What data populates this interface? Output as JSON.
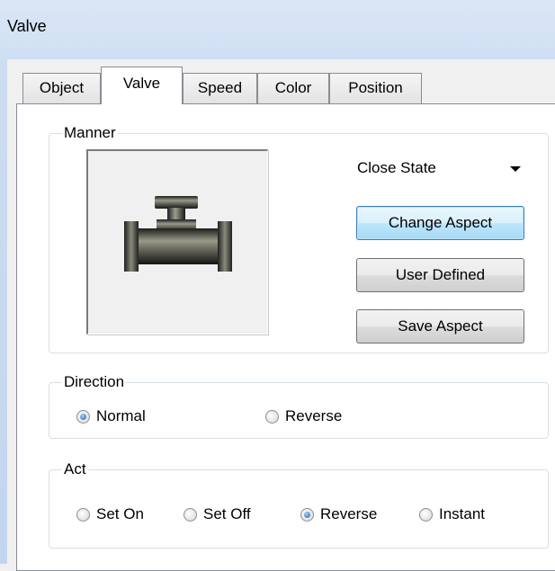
{
  "window": {
    "title": "Valve"
  },
  "tabs": [
    {
      "label": "Object",
      "active": false
    },
    {
      "label": "Valve",
      "active": true
    },
    {
      "label": "Speed",
      "active": false
    },
    {
      "label": "Color",
      "active": false
    },
    {
      "label": "Position",
      "active": false
    }
  ],
  "manner": {
    "legend": "Manner",
    "state_select": {
      "value": "Close State"
    },
    "buttons": {
      "change_aspect": "Change Aspect",
      "user_defined": "User Defined",
      "save_aspect": "Save Aspect"
    },
    "preview_icon": "valve-pipe-icon"
  },
  "direction": {
    "legend": "Direction",
    "options": [
      {
        "label": "Normal",
        "checked": true
      },
      {
        "label": "Reverse",
        "checked": false
      }
    ]
  },
  "act": {
    "legend": "Act",
    "options": [
      {
        "label": "Set On",
        "checked": false
      },
      {
        "label": "Set Off",
        "checked": false
      },
      {
        "label": "Reverse",
        "checked": true
      },
      {
        "label": "Instant",
        "checked": false
      }
    ]
  },
  "colors": {
    "titlebar": "#d6e4f6",
    "tab_border": "#898c95",
    "button_focus": "#3c7fb1",
    "radio_checked": "#1e5fa5"
  }
}
